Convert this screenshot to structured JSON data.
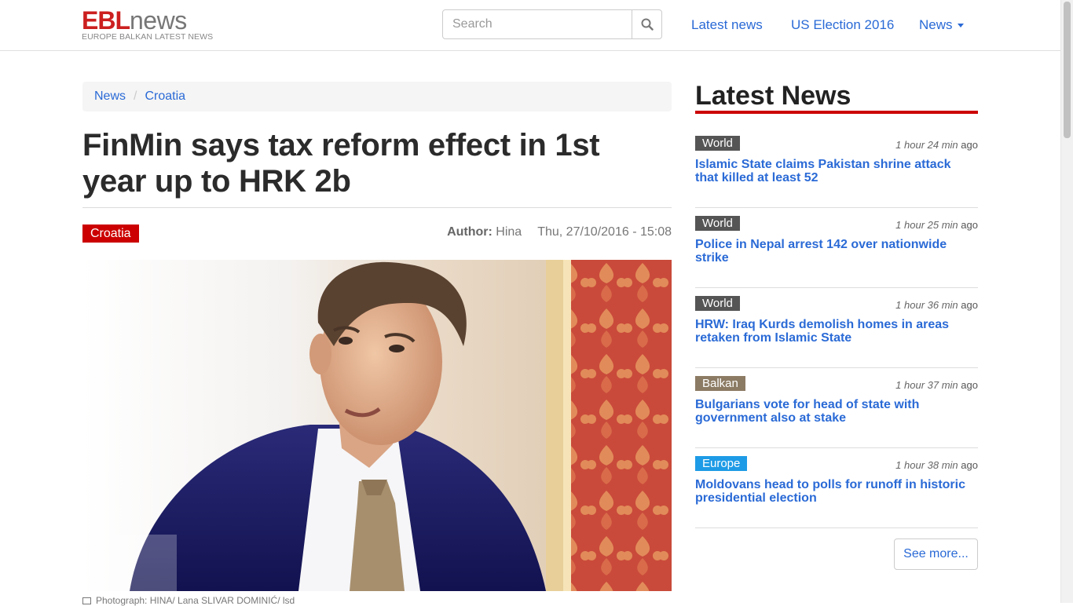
{
  "header": {
    "logo": {
      "ebl": "EBL",
      "news": "news",
      "tagline": "EUROPE BALKAN LATEST NEWS"
    },
    "search": {
      "placeholder": "Search",
      "value": ""
    },
    "nav": [
      {
        "label": "Latest news"
      },
      {
        "label": "US Election 2016"
      },
      {
        "label": "News"
      }
    ]
  },
  "breadcrumb": {
    "items": [
      "News",
      "Croatia"
    ],
    "separator": "/"
  },
  "article": {
    "headline": "FinMin says tax reform effect in 1st year up to HRK 2b",
    "category": "Croatia",
    "author_label": "Author:",
    "author": "Hina",
    "date": "Thu, 27/10/2016 - 15:08",
    "caption": "Photograph: HINA/ Lana SLIVAR DOMINIĆ/ lsd"
  },
  "sidebar": {
    "title": "Latest News",
    "ago_suffix": "ago",
    "items": [
      {
        "category": "World",
        "category_color": "#555555",
        "time": "1 hour 24 min",
        "title": "Islamic State claims Pakistan shrine attack that killed at least 52"
      },
      {
        "category": "World",
        "category_color": "#555555",
        "time": "1 hour 25 min",
        "title": "Police in Nepal arrest 142 over nationwide strike"
      },
      {
        "category": "World",
        "category_color": "#555555",
        "time": "1 hour 36 min",
        "title": "HRW: Iraq Kurds demolish homes in areas retaken from Islamic State"
      },
      {
        "category": "Balkan",
        "category_color": "#8c7b64",
        "time": "1 hour 37 min",
        "title": "Bulgarians vote for head of state with government also at stake"
      },
      {
        "category": "Europe",
        "category_color": "#1e9be6",
        "time": "1 hour 38 min",
        "title": "Moldovans head to polls for runoff in historic presidential election"
      }
    ],
    "see_more": "See more..."
  },
  "colors": {
    "brand_red": "#cc0000",
    "link_blue": "#2a6ad6"
  }
}
